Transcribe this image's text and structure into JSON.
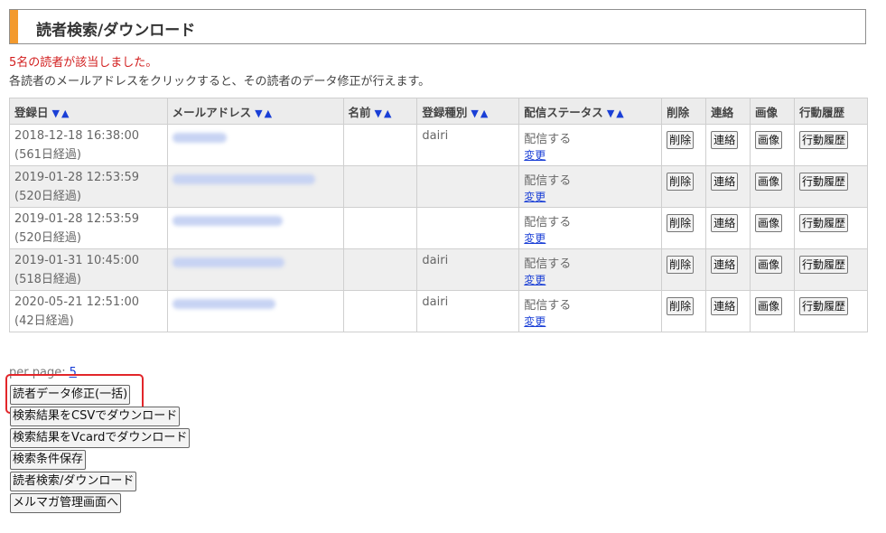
{
  "page": {
    "title": "読者検索/ダウンロード",
    "result_message": "5名の読者が該当しました。",
    "instruction": "各読者のメールアドレスをクリックすると、その読者のデータ修正が行えます。"
  },
  "table": {
    "headers": {
      "registered": "登録日",
      "email": "メールアドレス",
      "name": "名前",
      "reg_type": "登録種別",
      "delivery_status": "配信ステータス",
      "delete": "削除",
      "contact": "連絡",
      "image": "画像",
      "history": "行動履歴"
    },
    "sort_glyph": "▼▲",
    "rows": [
      {
        "date": "2018-12-18 16:38:00",
        "elapsed": "(561日経過)",
        "email_blur_width": 60,
        "name": "",
        "reg_type": "dairi",
        "status": "配信する",
        "change": "変更"
      },
      {
        "date": "2019-01-28 12:53:59",
        "elapsed": "(520日経過)",
        "email_blur_width": 158,
        "name": "",
        "reg_type": "",
        "status": "配信する",
        "change": "変更"
      },
      {
        "date": "2019-01-28 12:53:59",
        "elapsed": "(520日経過)",
        "email_blur_width": 122,
        "name": "",
        "reg_type": "",
        "status": "配信する",
        "change": "変更"
      },
      {
        "date": "2019-01-31 10:45:00",
        "elapsed": "(518日経過)",
        "email_blur_width": 124,
        "name": "",
        "reg_type": "dairi",
        "status": "配信する",
        "change": "変更"
      },
      {
        "date": "2020-05-21 12:51:00",
        "elapsed": "(42日経過)",
        "email_blur_width": 114,
        "name": "",
        "reg_type": "dairi",
        "status": "配信する",
        "change": "変更"
      }
    ],
    "row_buttons": {
      "delete": "削除",
      "contact": "連絡",
      "image": "画像",
      "history": "行動履歴"
    }
  },
  "pagination": {
    "label": "per page:",
    "value": "5"
  },
  "buttons": {
    "bulk_edit": "読者データ修正(一括)",
    "csv_download": "検索結果をCSVでダウンロード",
    "vcard_download": "検索結果をVcardでダウンロード",
    "save_conditions": "検索条件保存",
    "search_download": "読者検索/ダウンロード",
    "mail_admin": "メルマガ管理画面へ"
  },
  "colors": {
    "accent": "#f39a2e",
    "link": "#1a3fd6",
    "alert": "#d21e1e",
    "highlight": "#e2262a"
  }
}
